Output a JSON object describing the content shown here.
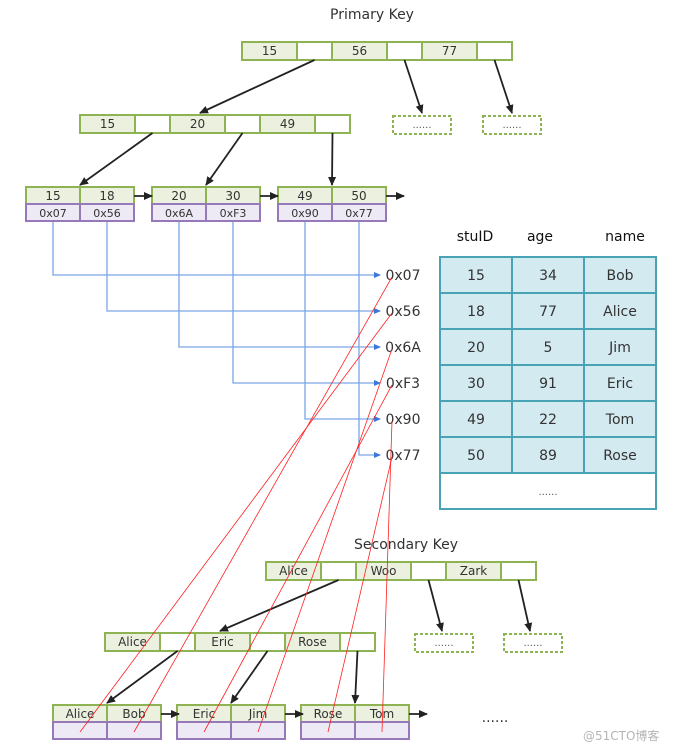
{
  "colors": {
    "key_fill": "#ebf1de",
    "node_border": "#8db352",
    "addr_fill": "#eeeaf5",
    "addr_border": "#9579b8",
    "pointer_line": "#7aa6e6",
    "table_fill": "#d3eaf0",
    "table_border": "#4aa3b5",
    "mapping_line": "#ff2020",
    "arrow": "#222222"
  },
  "primary": {
    "title": "Primary Key",
    "root_keys": [
      "15",
      "56",
      "77"
    ],
    "level2_keys": [
      "15",
      "20",
      "49"
    ],
    "leaves": [
      {
        "keys": [
          "15",
          "18"
        ],
        "addrs": [
          "0x07",
          "0x56"
        ]
      },
      {
        "keys": [
          "20",
          "30"
        ],
        "addrs": [
          "0x6A",
          "0xF3"
        ]
      },
      {
        "keys": [
          "49",
          "50"
        ],
        "addrs": [
          "0x90",
          "0x77"
        ]
      }
    ],
    "ellipsis_nodes": [
      "......",
      "......"
    ]
  },
  "pointers": [
    "0x07",
    "0x56",
    "0x6A",
    "0xF3",
    "0x90",
    "0x77"
  ],
  "table": {
    "columns": [
      "stuID",
      "age",
      "name"
    ],
    "rows": [
      [
        "15",
        "34",
        "Bob"
      ],
      [
        "18",
        "77",
        "Alice"
      ],
      [
        "20",
        "5",
        "Jim"
      ],
      [
        "30",
        "91",
        "Eric"
      ],
      [
        "49",
        "22",
        "Tom"
      ],
      [
        "50",
        "89",
        "Rose"
      ]
    ],
    "more": "......"
  },
  "secondary": {
    "title": "Secondary Key",
    "root_keys": [
      "Alice",
      "Woo",
      "Zark"
    ],
    "level2_keys": [
      "Alice",
      "Eric",
      "Rose"
    ],
    "leaves": [
      {
        "keys": [
          "Alice",
          "Bob"
        ]
      },
      {
        "keys": [
          "Eric",
          "Jim"
        ]
      },
      {
        "keys": [
          "Rose",
          "Tom"
        ]
      }
    ],
    "ellipsis_nodes": [
      "......",
      "......"
    ],
    "trailing": "......",
    "mappings": [
      {
        "from": "Alice",
        "to": "0x56"
      },
      {
        "from": "Bob",
        "to": "0x07"
      },
      {
        "from": "Eric",
        "to": "0xF3"
      },
      {
        "from": "Jim",
        "to": "0x6A"
      },
      {
        "from": "Rose",
        "to": "0x77"
      },
      {
        "from": "Tom",
        "to": "0x90"
      }
    ]
  },
  "watermark": "@51CTO博客"
}
